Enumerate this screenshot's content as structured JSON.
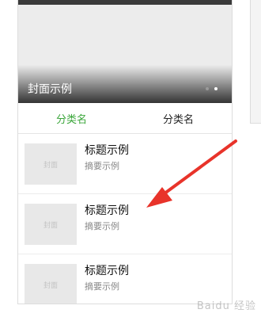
{
  "cover": {
    "title": "封面示例",
    "slide_count": 2,
    "active_slide": 2,
    "dot_color": "#9a9a9a",
    "dot_active_color": "#ffffff"
  },
  "tabs": [
    {
      "label": "分类名",
      "active": true
    },
    {
      "label": "分类名",
      "active": false
    }
  ],
  "accent_color": "#3aa63a",
  "list": [
    {
      "thumb_label": "封面",
      "title": "标题示例",
      "summary": "摘要示例"
    },
    {
      "thumb_label": "封面",
      "title": "标题示例",
      "summary": "摘要示例"
    },
    {
      "thumb_label": "封面",
      "title": "标题示例",
      "summary": "摘要示例"
    }
  ],
  "annotation": {
    "icon": "red-arrow-icon",
    "color": "#e8332a"
  },
  "watermark": {
    "text": "Baidu 经验"
  }
}
